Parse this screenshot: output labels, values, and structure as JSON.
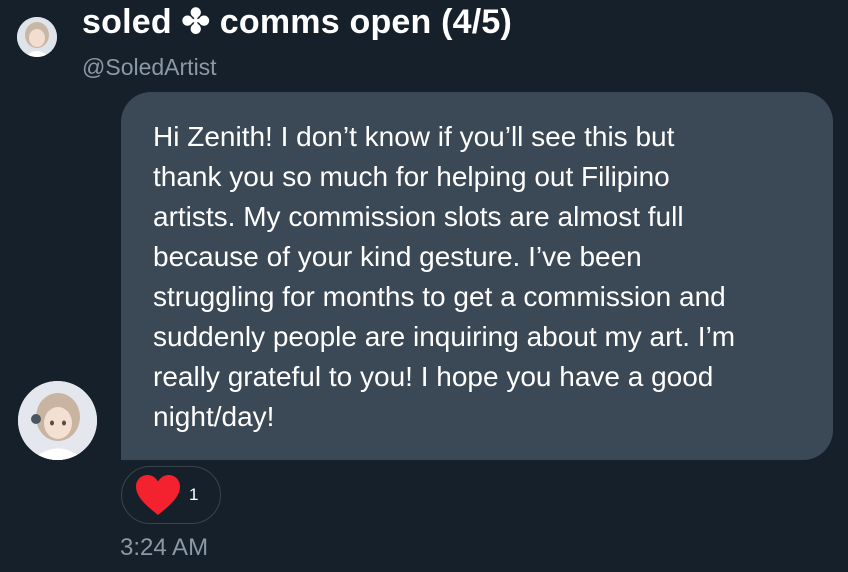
{
  "sender": {
    "display_name": "soled ✤ comms open (4/5)",
    "handle": "@SoledArtist"
  },
  "message": {
    "text": "Hi Zenith! I don’t know if you’ll see this but\nthank you so much for helping out Filipino\nartists. My commission slots are almost full\nbecause of your kind gesture. I’ve been\nstruggling for months to get a commission and\nsuddenly people are inquiring about my art. I’m\nreally grateful to you! I hope you have a good\nnight/day!",
    "timestamp": "3:24 AM"
  },
  "reaction": {
    "icon": "heart-icon",
    "count": "1",
    "color": "#f4212e"
  },
  "colors": {
    "background": "#15202b",
    "bubble": "#3b4856",
    "secondary_text": "#8b98a5"
  }
}
